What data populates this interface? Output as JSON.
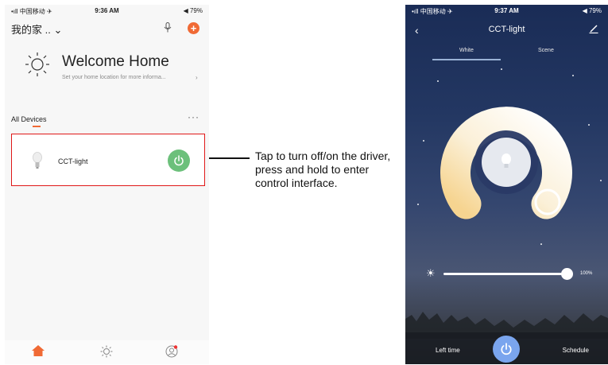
{
  "left_phone": {
    "status": {
      "carrier": "•ıll 中国移动 ✈",
      "time": "9:36 AM",
      "battery": "◀ 79%"
    },
    "home_title": "我的家 .. ⌄",
    "welcome": "Welcome Home",
    "welcome_sub": "Set your home location for more informa...",
    "welcome_arrow": "›",
    "tab": "All Devices",
    "more": "···",
    "device": {
      "name": "CCT-light"
    }
  },
  "annotation": {
    "text": "Tap to turn off/on the driver, press and hold to enter control interface."
  },
  "right_phone": {
    "status": {
      "carrier": "•ıll 中国移动 ✈",
      "time": "9:37 AM",
      "battery": "◀ 79%"
    },
    "back": "‹",
    "title": "CCT-light",
    "tabs": [
      "White",
      "Scene"
    ],
    "brightness": {
      "value_label": "100%",
      "level": 1.0
    },
    "bottom": {
      "left_time": "Left time",
      "schedule": "Schedule"
    }
  },
  "colors": {
    "accent": "#f06a35",
    "power_green": "#6cc07b",
    "power_blue": "#7aa5ee",
    "highlight_border": "#e01818"
  }
}
